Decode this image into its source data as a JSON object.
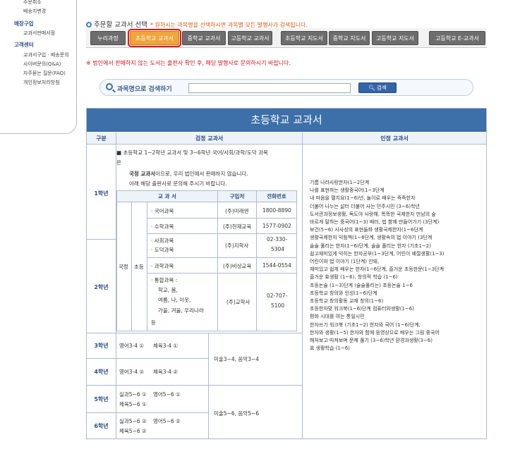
{
  "sidebar": {
    "items_top": [
      "주문취소",
      "배송지변경"
    ],
    "section1": {
      "title": "매장구입",
      "items": [
        "교과서판매서점"
      ]
    },
    "section2": {
      "title": "고객센터",
      "items": [
        "교과서구입 · 배송문의",
        "사이버문의(Q&A)",
        "자주묻는 질문(FAQ)",
        "개인정보처리방침"
      ]
    }
  },
  "selector": {
    "title": "주문할 교과서 선택",
    "notice": "* 원하시는 과목명을 선택하시면 과목별 모든 발행사가 검색됩니다."
  },
  "tabs": [
    {
      "label": "누리과정",
      "active": false
    },
    {
      "label": "초등학교 교과서",
      "active": true
    },
    {
      "label": "중학교 교과서",
      "active": false
    },
    {
      "label": "고등학교 교과서",
      "active": false
    },
    {
      "label": "초등학교 지도서",
      "active": false
    },
    {
      "label": "중학교 지도서",
      "active": false
    },
    {
      "label": "고등학교 지도서",
      "active": false
    },
    {
      "label": "고등학교 E-교과서",
      "active": false
    }
  ],
  "red_notice": "※ 법인에서 판매하지 않는 도서는 출판사 확인 후, 해당 발행사로 문의하시기 바랍니다.",
  "search": {
    "label": "과목명으로 검색하기",
    "placeholder": "",
    "button": "검색"
  },
  "content": {
    "title": "초등학교 교과서",
    "headers": {
      "grade": "구분",
      "authorized": "검정 교과서",
      "approved": "인정 교과서"
    },
    "note": {
      "line1": "■ 초등학교 1~2학년 교과서 및 3~6학년 국어/사회/과학/도덕 과목",
      "line2": "은",
      "line3_bold": "국정 교과서",
      "line3_rest": "이므로, 우리 법인에서 판매하지 않습니다.",
      "line4": "아래 해당 출판사로 문의해 주시기 바랍니다."
    },
    "grades": [
      "1학년",
      "2학년",
      "3학년",
      "4학년",
      "5학년",
      "6학년"
    ],
    "inner_table": {
      "headers": [
        "교 과 서",
        "구입처",
        "전화번호"
      ],
      "type_label": "국정",
      "level_label": "초등",
      "rows": [
        {
          "subject": "· 국어과목",
          "publisher": "(주)미래엔",
          "phone": "1800-8890"
        },
        {
          "subject": "· 수학과목",
          "publisher": "(주)천재교육",
          "phone": "1577-0902"
        },
        {
          "subject": "· 사회과목",
          "subject2": "· 도덕과목",
          "publisher": "(주)지학사",
          "phone": "02-330-",
          "phone2": "5304"
        },
        {
          "subject": "· 과학과목",
          "publisher": "(주)비상교육",
          "phone": "1544-0554"
        },
        {
          "subject": "· 통합과목 :",
          "sub_lines": [
            "학교, 봄,",
            "여름, 나, 이웃,",
            "가을, 겨울, 우리나라",
            "등"
          ],
          "publisher": "(주)교학사",
          "phone": "02-707-",
          "phone2": "5100"
        }
      ]
    },
    "grade3": {
      "a": "영어3-4 ①",
      "b": "체육3-4 ①"
    },
    "grade4": {
      "a": "영어3-4 ②",
      "b": "체육3-4 ②"
    },
    "grade34_right": "미술3~4,   음악3~4",
    "grade5": {
      "a": "실과5~6 ①",
      "b": "영어5~6 ①",
      "c": "체육5~6 ①"
    },
    "grade6": {
      "a": "실과5~6 ②",
      "b": "영어5~6 ②",
      "c": "체육5~6 ②"
    },
    "grade56_right": "미술5~6,   음악5~6",
    "approved_list": [
      "기름    나라사랑한자(1~2단계",
      "나를 표현하는 생활중국어(1~3단계",
      "내 마음을 펼치요(1~6)년,   놀이로 배우는 즉즉한자",
      "더불어 나누는 삶터   더불어 사는 민주시민 (3~6)학년",
      "도서관과정보생활,   독도야 사랑해,   똑똑한 국제한자   만남의 숲",
      "바르게 말하는 중국어(1~3)   배러,   법 함께 만들어가기 (3단계)",
      "보건(5~6)    사사성의 표현들화   생활국제한자(1~6단계",
      "생활국제한자 익힘책(1~6단계,    생활속의 법 이야기 (3단계",
      "술술 풀리는 한자(1~6)단계,    술술 풀리는 한자 (기초1~2)",
      "쉽고재미있게 익히는 한자공부(1~3단계,   어린이 예절생활(1~3)",
      "어린이와 법 이야기 (1단계)    안돼,",
      "재미있고 쉽게 배우는 한자(1~6단계,     즐거운 초등한문(1~3단계",
      "즐거운 효생활 (1~6),     창의적 학습 (1~6)",
      "초등논술 (1~3)단계 (술술풀리는)    초등논술 1~6",
      "초등학교 창의와 인성(1~6)단계",
      "초등학교 창의활동 교재 창의(1~6)",
      "초등한자맞 워크북(1~6)단계    컴퓨터와생활(1~6)",
      "평화 시대를 여는 통일시민",
      "한자쓰기 워크북 (기초1~2)    한자와 국어 (1~6)단계,",
      "한자와 생활(1~5)    한자와 함께 등영상으로 배우는 그림 중국어",
      "해처보고 따져보며 문제 풀기 (3~6)학년    환경과생활(3~6)",
      "효 생활학습 (1~6)"
    ]
  }
}
